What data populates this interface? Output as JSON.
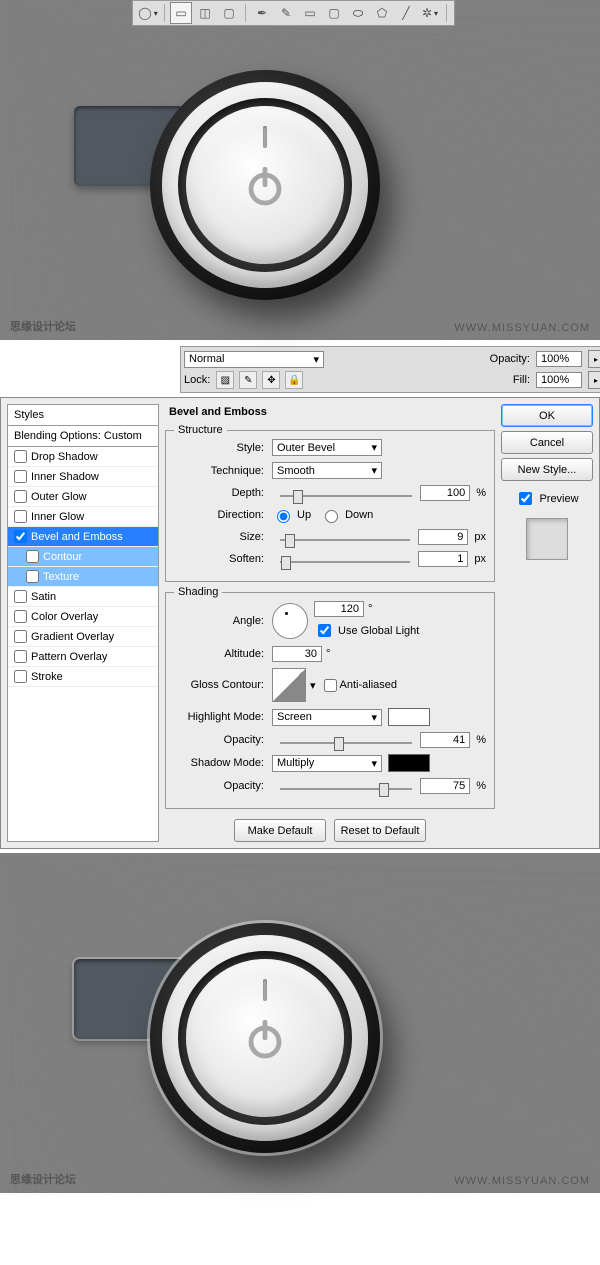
{
  "watermark": {
    "left": "思缘设计论坛",
    "right": "WWW.MISSYUAN.COM"
  },
  "layer_panel": {
    "blend_mode": "Normal",
    "opacity_label": "Opacity:",
    "opacity_value": "100%",
    "lock_label": "Lock:",
    "fill_label": "Fill:",
    "fill_value": "100%"
  },
  "dialog": {
    "styles_header": "Styles",
    "blending_header": "Blending Options: Custom",
    "effects": {
      "drop_shadow": "Drop Shadow",
      "inner_shadow": "Inner Shadow",
      "outer_glow": "Outer Glow",
      "inner_glow": "Inner Glow",
      "bevel_emboss": "Bevel and Emboss",
      "contour": "Contour",
      "texture": "Texture",
      "satin": "Satin",
      "color_overlay": "Color Overlay",
      "gradient_overlay": "Gradient Overlay",
      "pattern_overlay": "Pattern Overlay",
      "stroke": "Stroke"
    },
    "title": "Bevel and Emboss",
    "structure": {
      "legend": "Structure",
      "style_label": "Style:",
      "style_value": "Outer Bevel",
      "technique_label": "Technique:",
      "technique_value": "Smooth",
      "depth_label": "Depth:",
      "depth_value": "100",
      "depth_unit": "%",
      "direction_label": "Direction:",
      "direction_up": "Up",
      "direction_down": "Down",
      "size_label": "Size:",
      "size_value": "9",
      "size_unit": "px",
      "soften_label": "Soften:",
      "soften_value": "1",
      "soften_unit": "px"
    },
    "shading": {
      "legend": "Shading",
      "angle_label": "Angle:",
      "angle_value": "120",
      "angle_unit": "°",
      "global_light": "Use Global Light",
      "altitude_label": "Altitude:",
      "altitude_value": "30",
      "altitude_unit": "°",
      "gloss_contour_label": "Gloss Contour:",
      "anti_aliased": "Anti-aliased",
      "highlight_mode_label": "Highlight Mode:",
      "highlight_mode_value": "Screen",
      "highlight_opacity_label": "Opacity:",
      "highlight_opacity_value": "41",
      "highlight_opacity_unit": "%",
      "shadow_mode_label": "Shadow Mode:",
      "shadow_mode_value": "Multiply",
      "shadow_opacity_label": "Opacity:",
      "shadow_opacity_value": "75",
      "shadow_opacity_unit": "%"
    },
    "make_default": "Make Default",
    "reset_default": "Reset to Default",
    "ok": "OK",
    "cancel": "Cancel",
    "new_style": "New Style...",
    "preview": "Preview"
  },
  "colors": {
    "highlight": "#ffffff",
    "shadow": "#000000"
  }
}
